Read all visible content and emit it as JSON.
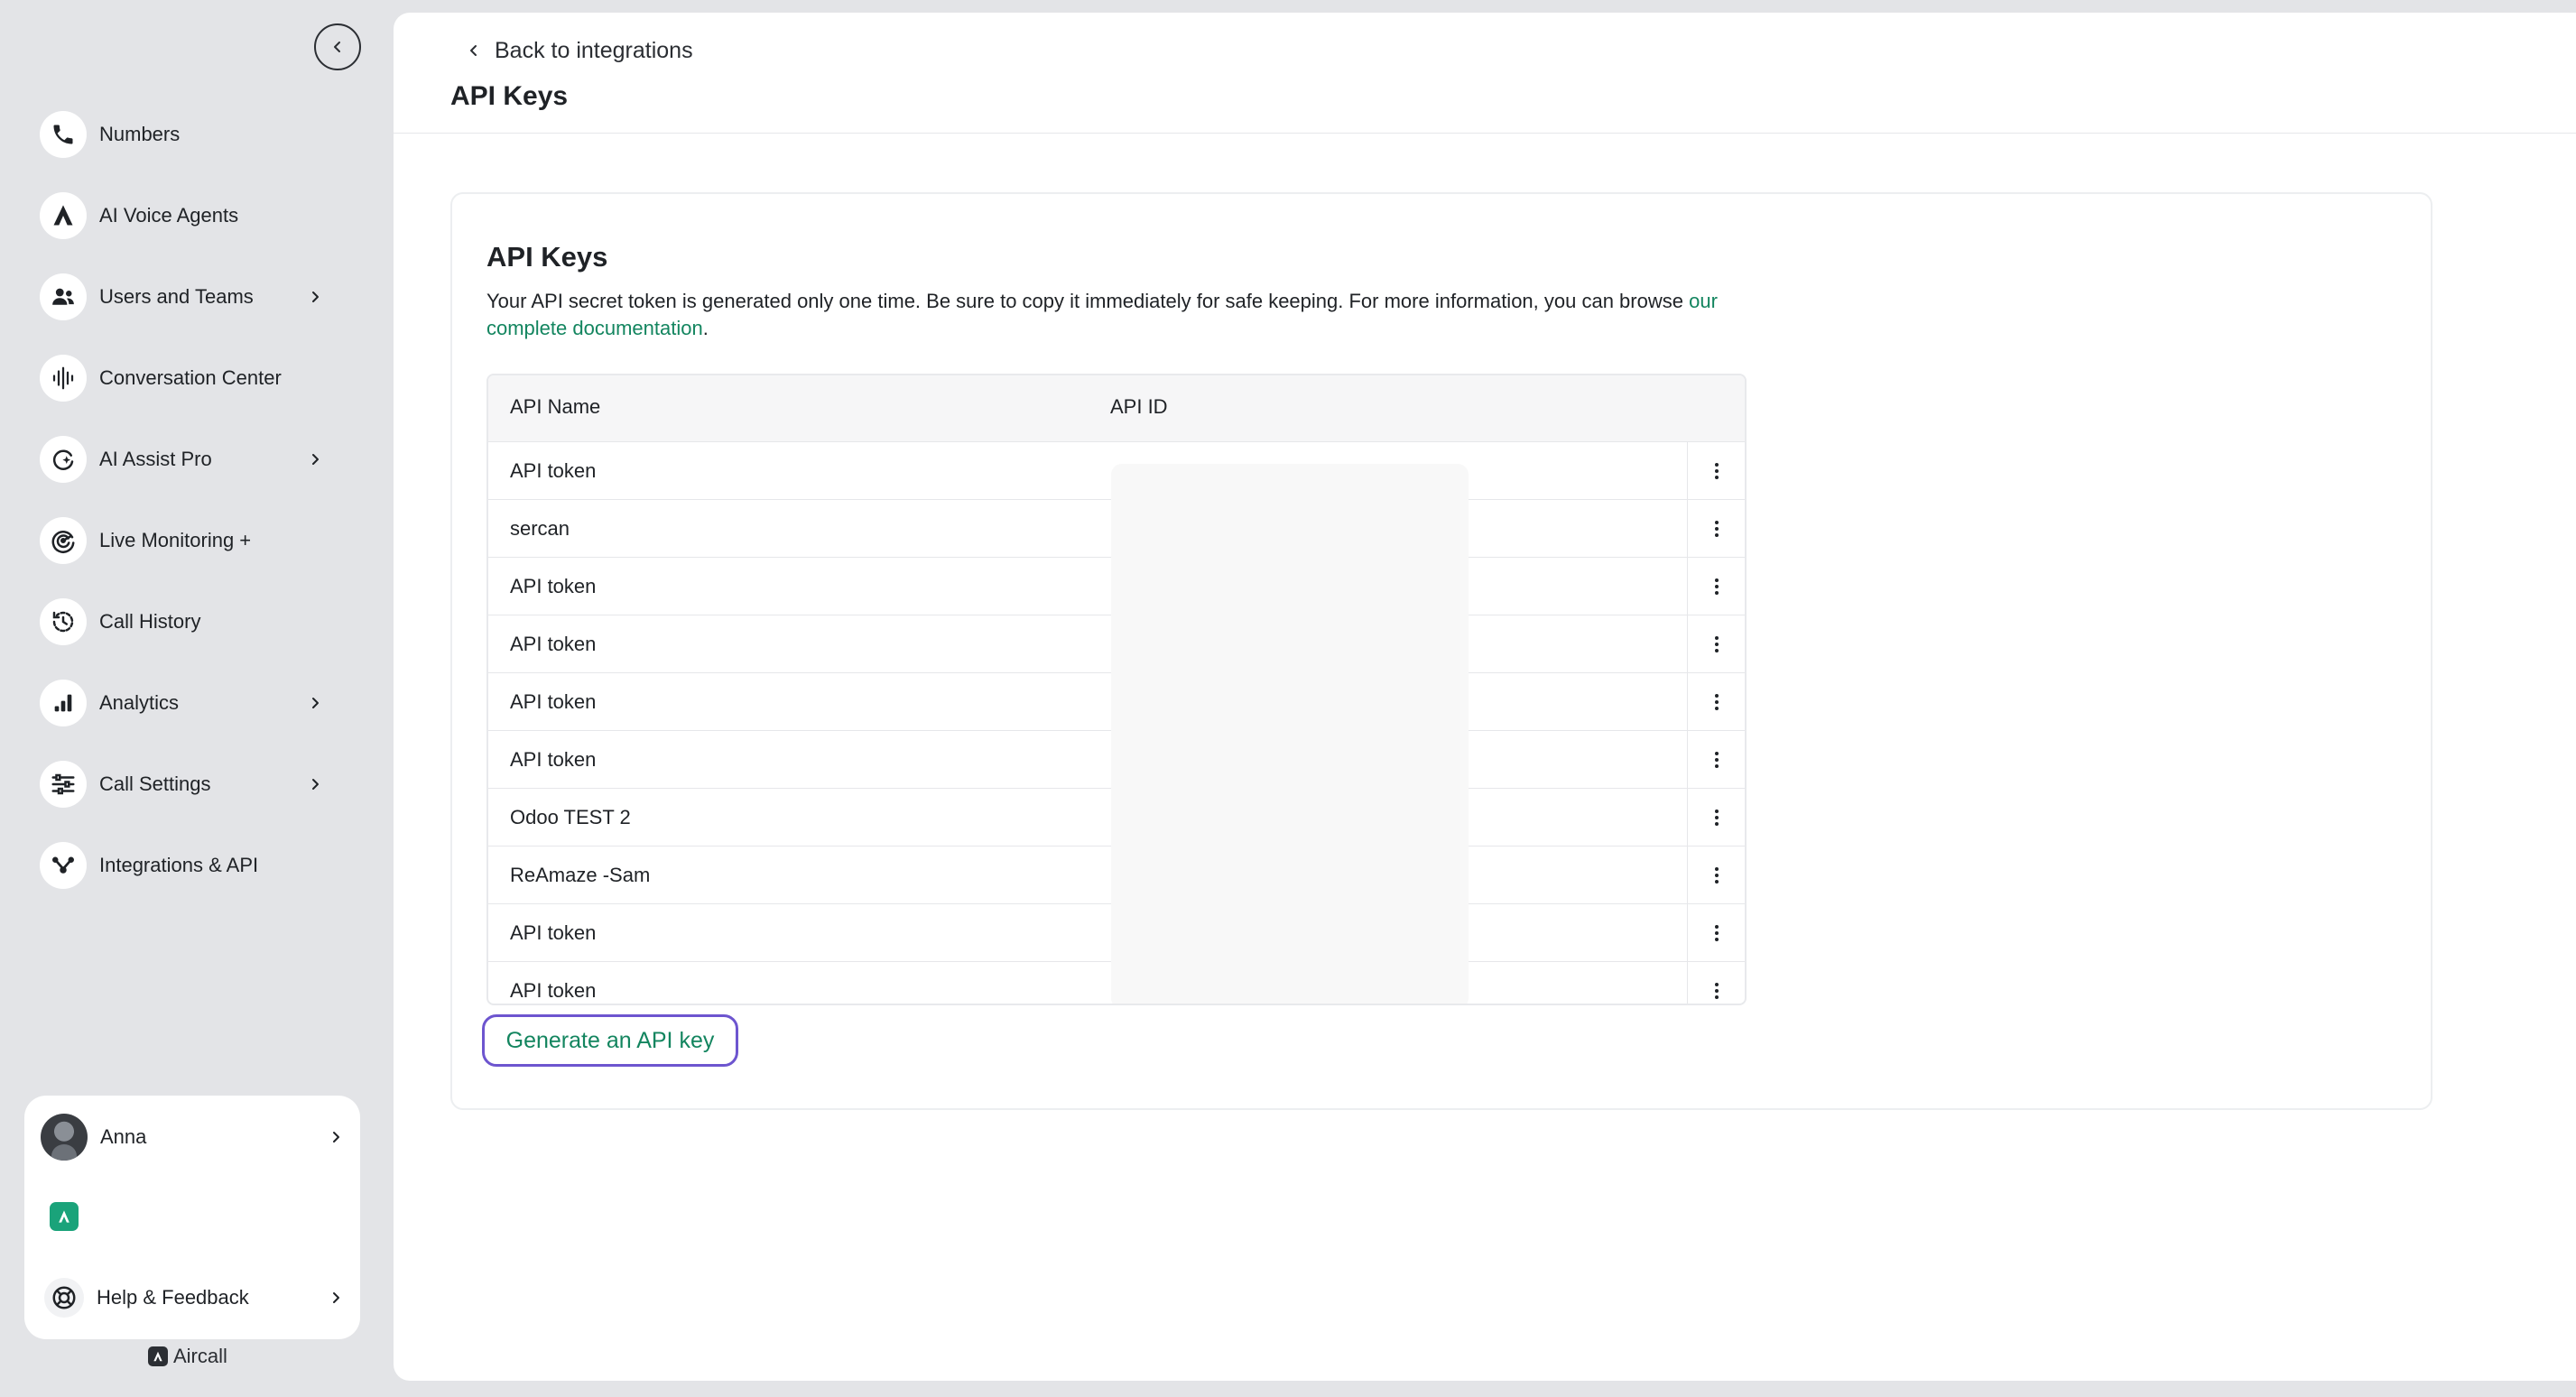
{
  "sidebar": {
    "items": [
      {
        "label": "Numbers",
        "icon": "phone-icon",
        "has_chevron": false
      },
      {
        "label": "AI Voice Agents",
        "icon": "ai-agent-icon",
        "has_chevron": false
      },
      {
        "label": "Users and Teams",
        "icon": "users-icon",
        "has_chevron": true
      },
      {
        "label": "Conversation Center",
        "icon": "soundwave-icon",
        "has_chevron": false
      },
      {
        "label": "AI Assist Pro",
        "icon": "ai-assist-icon",
        "has_chevron": true
      },
      {
        "label": "Live Monitoring +",
        "icon": "live-monitoring-icon",
        "has_chevron": false
      },
      {
        "label": "Call History",
        "icon": "history-icon",
        "has_chevron": false
      },
      {
        "label": "Analytics",
        "icon": "analytics-icon",
        "has_chevron": true
      },
      {
        "label": "Call Settings",
        "icon": "sliders-icon",
        "has_chevron": true
      },
      {
        "label": "Integrations & API",
        "icon": "integrations-icon",
        "has_chevron": false
      }
    ],
    "account": {
      "name": "Anna"
    },
    "help": {
      "label": "Help & Feedback"
    },
    "brand": {
      "label": "Aircall"
    }
  },
  "header": {
    "back_label": "Back to integrations",
    "title": "API Keys"
  },
  "card": {
    "title": "API Keys",
    "description": "Your API secret token is generated only one time. Be sure to copy it immediately for safe keeping. For more information, you can browse ",
    "doc_link": "our complete documentation",
    "description_end": "."
  },
  "table": {
    "columns": [
      "API Name",
      "API ID"
    ],
    "rows": [
      {
        "name": "API token"
      },
      {
        "name": "sercan"
      },
      {
        "name": "API token"
      },
      {
        "name": "API token"
      },
      {
        "name": "API token"
      },
      {
        "name": "API token"
      },
      {
        "name": "Odoo TEST 2"
      },
      {
        "name": "ReAmaze -Sam"
      },
      {
        "name": "API token"
      },
      {
        "name": "API token"
      }
    ]
  },
  "actions": {
    "generate_label": "Generate an API key"
  },
  "colors": {
    "accent_green": "#13855f",
    "focus_purple": "#6d55cf",
    "sidebar_bg": "#e3e4e7"
  }
}
